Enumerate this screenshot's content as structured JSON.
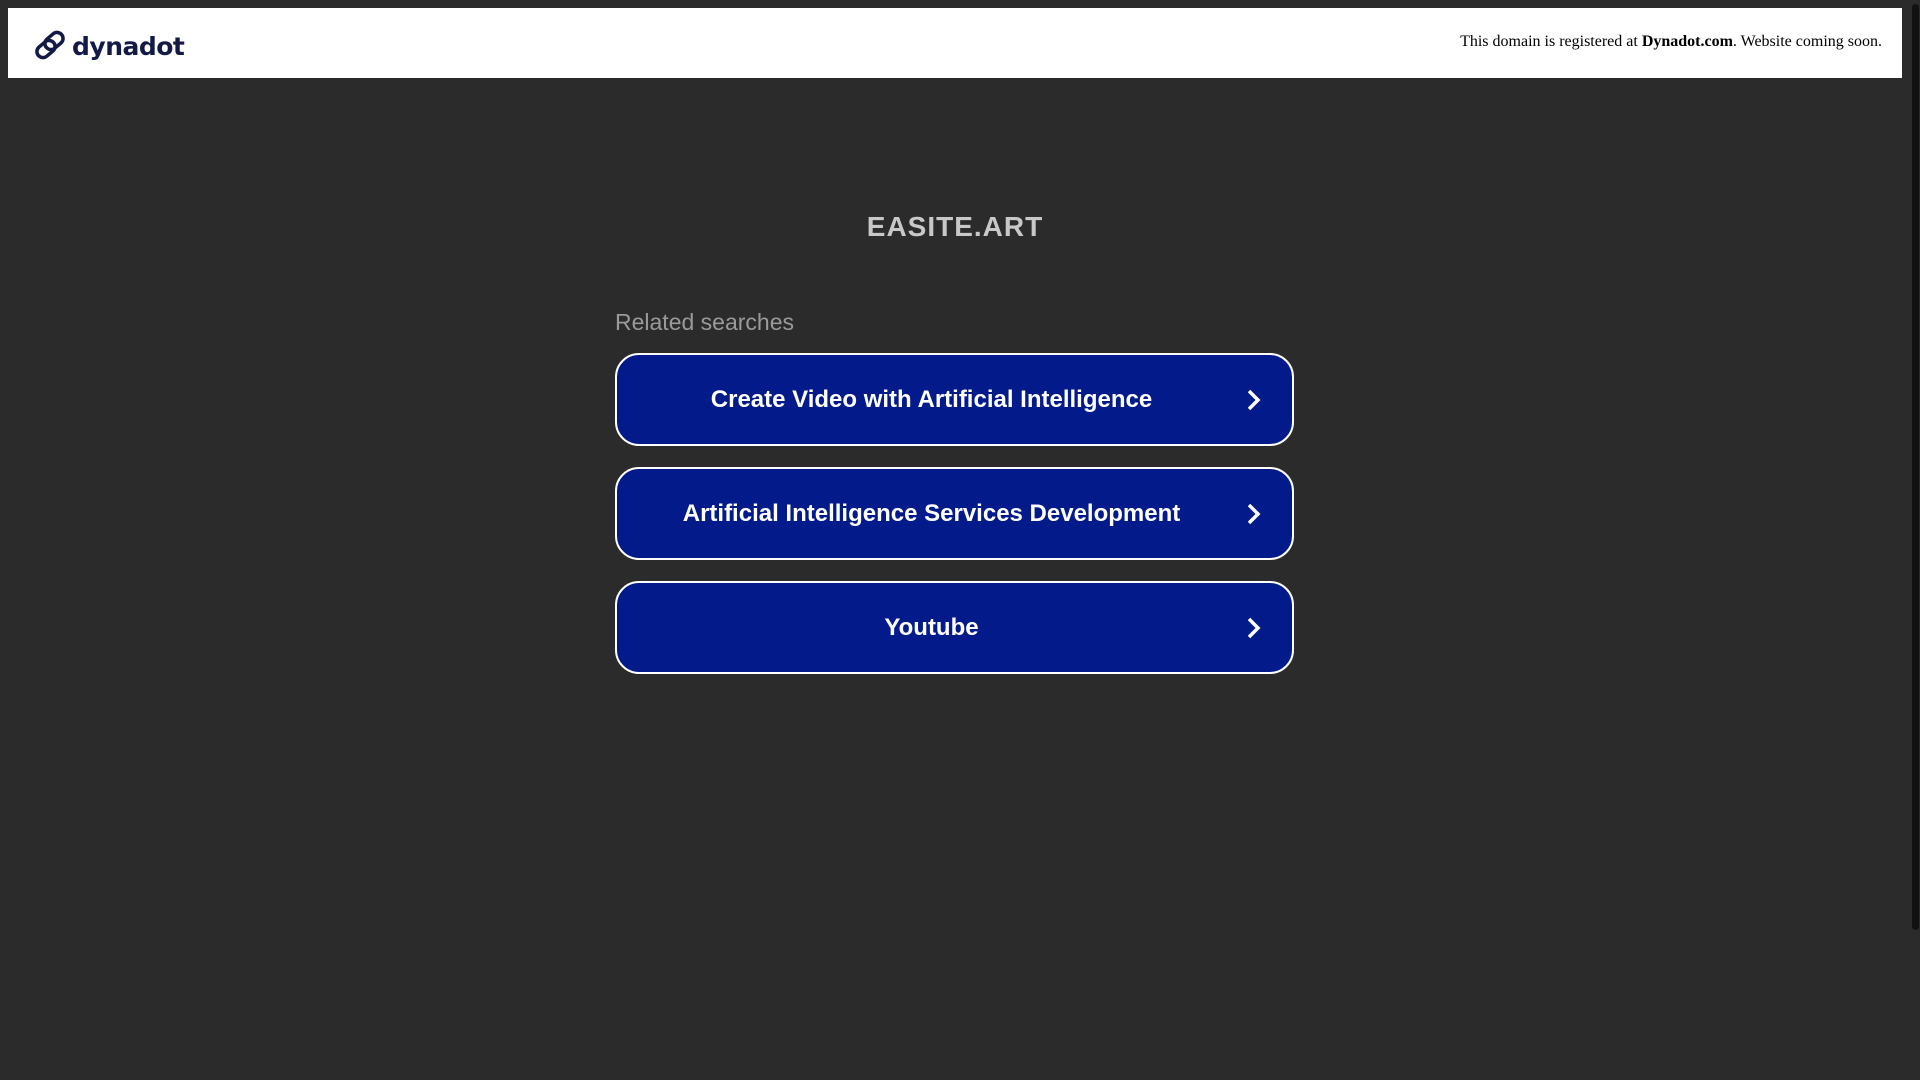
{
  "header": {
    "logo_text": "dynadot",
    "registered_prefix": "This domain is registered at ",
    "registrar": "Dynadot.com",
    "registered_suffix": ". Website coming soon."
  },
  "main": {
    "domain_title": "EASITE.ART",
    "related_label": "Related searches",
    "links": [
      {
        "label": "Create Video with Artificial Intelligence"
      },
      {
        "label": "Artificial Intelligence Services Development"
      },
      {
        "label": "Youtube"
      }
    ]
  },
  "colors": {
    "button_bg": "#021a8a",
    "page_bg": "#2b2b2b",
    "logo": "#141a46"
  }
}
